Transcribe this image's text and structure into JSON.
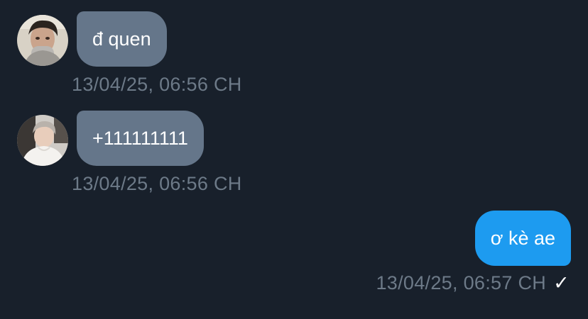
{
  "conversation": {
    "messages": [
      {
        "direction": "incoming",
        "text": "đ quen",
        "timestamp": "13/04/25, 06:56 CH",
        "avatar": "user-avatar-photo"
      },
      {
        "direction": "incoming",
        "text": "+111111111",
        "timestamp": "13/04/25, 06:56 CH",
        "avatar": "user-avatar-photo"
      },
      {
        "direction": "outgoing",
        "text": "ơ kè ae",
        "timestamp": "13/04/25, 06:57 CH",
        "status_icon": "✓",
        "status_icon_name": "sent-check-icon"
      }
    ]
  },
  "colors": {
    "background": "#18202b",
    "incoming_bubble": "#65768a",
    "outgoing_bubble": "#1d9bf0",
    "timestamp_text": "#6d7a88",
    "message_text": "#ffffff"
  }
}
